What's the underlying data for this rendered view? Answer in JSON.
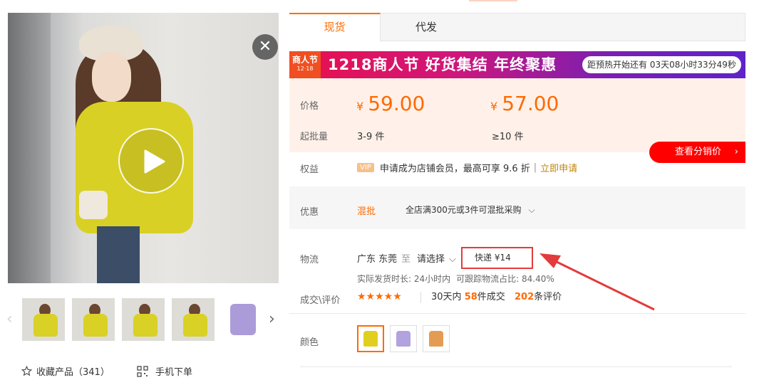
{
  "gallery": {
    "close_glyph": "✕",
    "thumbnails": [
      "yellow-sweater-1",
      "yellow-sweater-2",
      "yellow-sweater-3",
      "yellow-sweater-4",
      "purple-sweater"
    ],
    "favorites_label": "收藏产品（341）",
    "mobile_order_label": "手机下单"
  },
  "tabs": [
    {
      "label": "现货"
    },
    {
      "label": "代发"
    }
  ],
  "banner": {
    "logo_line1": "商人节",
    "logo_line2": "12·18",
    "title": "1218商人节 好货集结 年终聚惠",
    "countdown": "距预热开始还有 03天08小时33分49秒",
    "colors": {
      "start": "#e8114b",
      "end": "#5e23c9"
    }
  },
  "pricing": {
    "price_label": "价格",
    "moq_label": "起批量",
    "currency": "¥",
    "tiers": [
      {
        "price": "59.00",
        "qty": "3-9 件"
      },
      {
        "price": "57.00",
        "qty": "≥10 件"
      }
    ],
    "accent_color": "#ff6a00"
  },
  "distribution_button": "查看分销价",
  "rights": {
    "label": "权益",
    "vip_tag": "VIP",
    "text": "申请成为店铺会员，最高可享 9.6 折",
    "separator": "|",
    "apply_link": "立即申请"
  },
  "discount": {
    "label": "优惠",
    "tag": "混批",
    "text": "全店满300元或3件可混批采购"
  },
  "logistics": {
    "label": "物流",
    "from": "广东 东莞",
    "to_word": "至",
    "select_placeholder": "请选择",
    "express": "快递 ¥14",
    "ship_time": "实际发货时长: 24小时内",
    "tracking_ratio": "可跟踪物流占比: 84.40%"
  },
  "deals": {
    "label": "成交\\评价",
    "rating": 4.5,
    "stars_text": "★★★★★",
    "deals_prefix": "30天内",
    "deals_count": "58",
    "deals_suffix": "件成交",
    "reviews_count": "202",
    "reviews_suffix": "条评价"
  },
  "colors": {
    "label": "颜色",
    "options": [
      {
        "name": "yellow",
        "hex": "#e0cf1f",
        "selected": true
      },
      {
        "name": "purple",
        "hex": "#b2a2dd",
        "selected": false
      },
      {
        "name": "orange",
        "hex": "#e49c53",
        "selected": false
      }
    ]
  }
}
